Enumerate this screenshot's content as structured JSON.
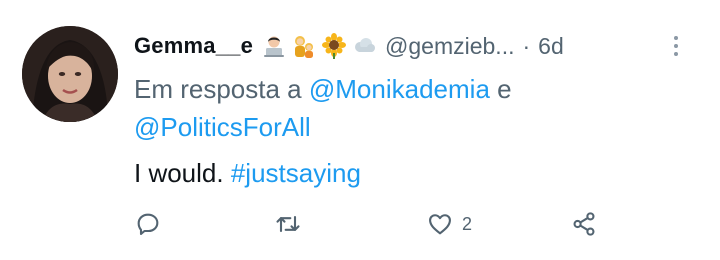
{
  "tweet": {
    "display_name": "Gemma__e",
    "handle": "@gemzieb...",
    "separator": "·",
    "time": "6d",
    "emojis": [
      "woman-technologist-icon",
      "family-icon",
      "sunflower-icon",
      "cloud-icon"
    ],
    "reply_prefix": "Em resposta a",
    "reply_mention_1": "@Monikademia",
    "reply_joiner": "e",
    "reply_mention_2": "@PoliticsForAll",
    "body_text": "I would.",
    "hashtag": "#justsaying"
  },
  "actions": {
    "reply_count": "",
    "retweet_count": "",
    "like_count": "2"
  },
  "colors": {
    "link": "#1d9bf0",
    "muted": "#536471",
    "text": "#0f1419"
  }
}
